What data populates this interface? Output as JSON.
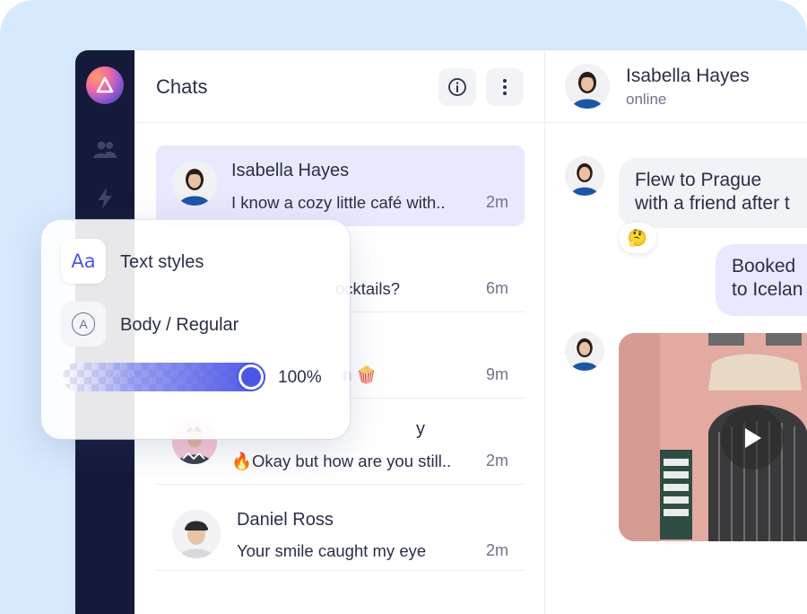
{
  "colors": {
    "accent": "#4c56e6",
    "rail": "#141a3a",
    "active_chat": "#e8e9fd",
    "backdrop": "#d7e9fd"
  },
  "rail": {
    "icons": [
      "logo",
      "users-icon",
      "bolt-icon"
    ]
  },
  "chats": {
    "title": "Chats",
    "header_icons": [
      "info-icon",
      "more-vertical-icon"
    ],
    "items": [
      {
        "name": "Isabella Hayes",
        "preview": "I know a cozy little café with..",
        "time": "2m",
        "active": true
      },
      {
        "name": "",
        "preview": "ocktails?",
        "time": "6m"
      },
      {
        "name": "",
        "preview": "n 🍿",
        "time": "9m"
      },
      {
        "name": "y",
        "preview": "🔥Okay but how are you still..",
        "time": "2m"
      },
      {
        "name": "Daniel Ross",
        "preview": "Your smile caught my eye",
        "time": "2m"
      }
    ]
  },
  "conversation": {
    "name": "Isabella Hayes",
    "status": "online",
    "messages": [
      {
        "direction": "in",
        "lines": [
          "Flew to Prague",
          "with a friend after t"
        ],
        "reaction": "🤔"
      },
      {
        "direction": "out",
        "lines": [
          "Booked",
          "to Icelan"
        ]
      },
      {
        "direction": "in",
        "type": "video"
      }
    ]
  },
  "text_styles": {
    "title_icon": "Aa",
    "title": "Text styles",
    "style_icon": "A",
    "style_label": "Body / Regular",
    "opacity_value": "100%",
    "opacity_fraction": 1.0
  }
}
